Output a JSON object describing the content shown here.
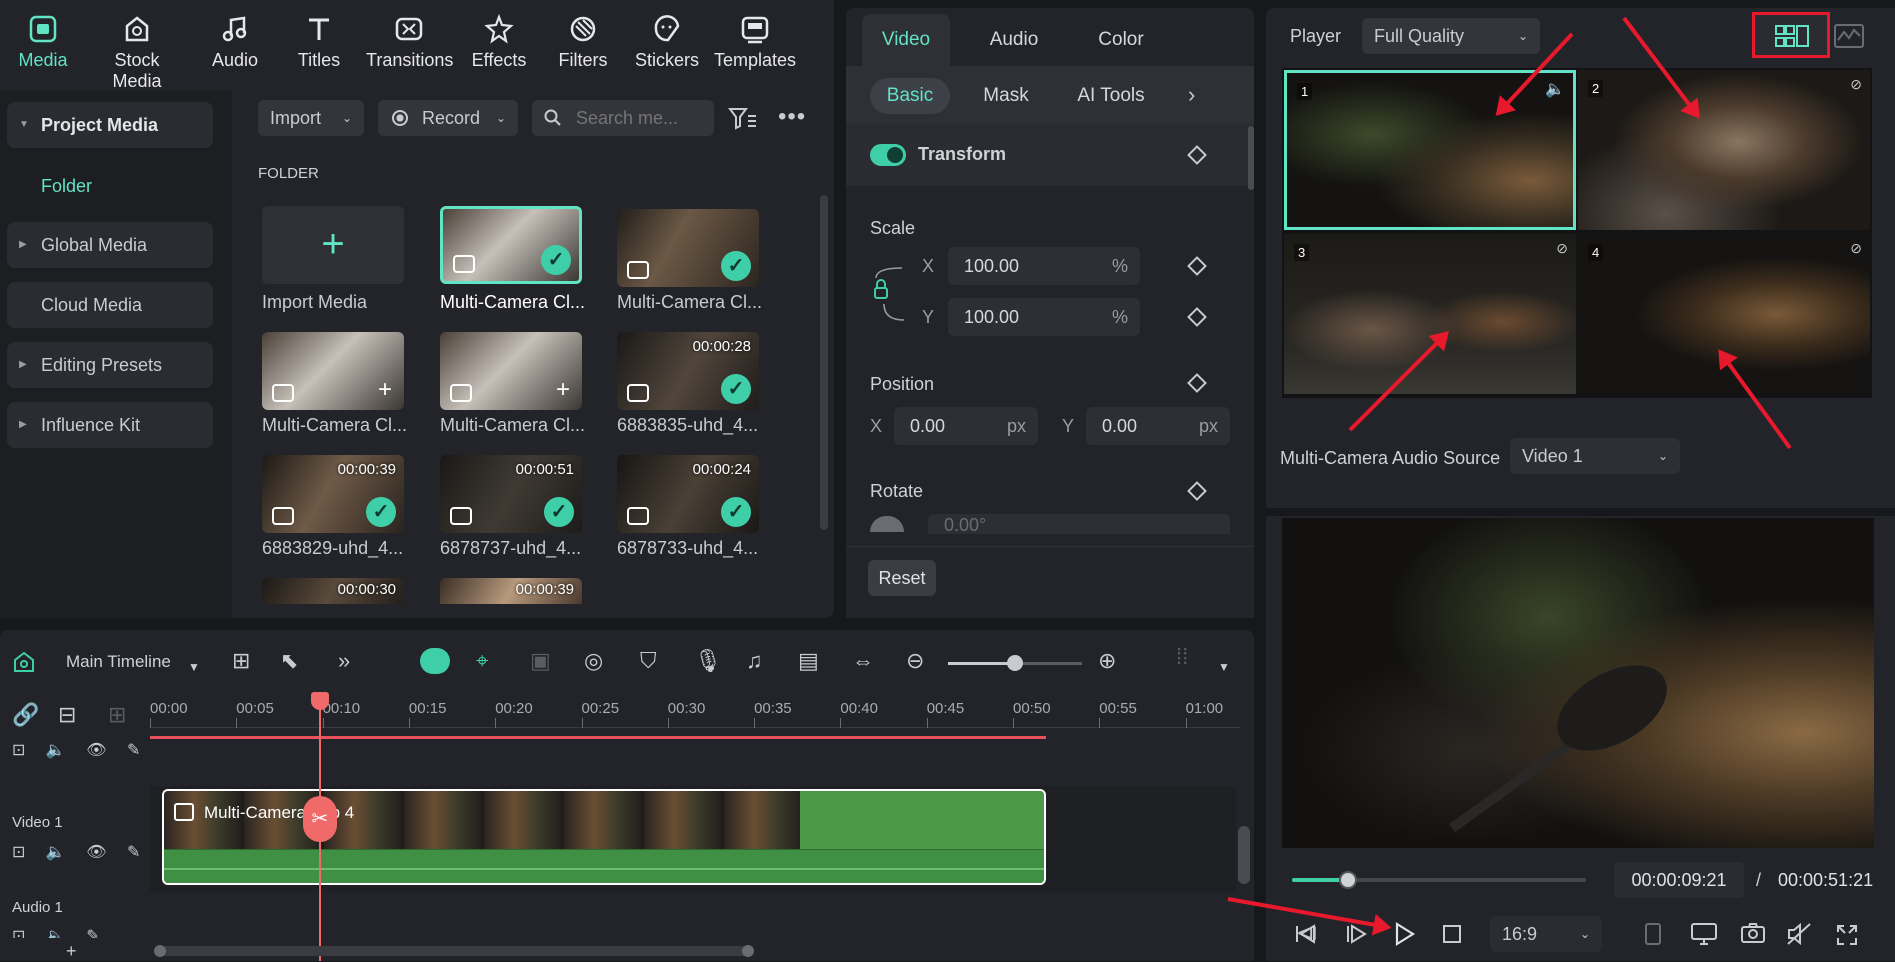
{
  "toolbar": {
    "items": [
      {
        "label": "Media",
        "icon": "media-icon"
      },
      {
        "label": "Stock Media",
        "icon": "stock-media-icon"
      },
      {
        "label": "Audio",
        "icon": "audio-icon"
      },
      {
        "label": "Titles",
        "icon": "titles-icon"
      },
      {
        "label": "Transitions",
        "icon": "transitions-icon"
      },
      {
        "label": "Effects",
        "icon": "effects-icon"
      },
      {
        "label": "Filters",
        "icon": "filters-icon"
      },
      {
        "label": "Stickers",
        "icon": "stickers-icon"
      },
      {
        "label": "Templates",
        "icon": "templates-icon"
      }
    ],
    "accent": "#61e3c5"
  },
  "sidebar": {
    "items": [
      "Project Media",
      "Folder",
      "Global Media",
      "Cloud Media",
      "Editing Presets",
      "Influence Kit"
    ]
  },
  "media": {
    "import_label": "Import",
    "record_label": "Record",
    "search_placeholder": "Search me...",
    "folder_heading": "FOLDER",
    "import_media_label": "Import Media",
    "clips": [
      {
        "label": "Multi-Camera Cl...",
        "duration": "",
        "state": "check"
      },
      {
        "label": "Multi-Camera Cl...",
        "duration": "",
        "state": "check"
      },
      {
        "label": "Multi-Camera Cl...",
        "duration": "",
        "state": "plus"
      },
      {
        "label": "Multi-Camera Cl...",
        "duration": "",
        "state": "plus"
      },
      {
        "label": "6883835-uhd_4...",
        "duration": "00:00:28",
        "state": "check"
      },
      {
        "label": "6883829-uhd_4...",
        "duration": "00:00:39",
        "state": "check"
      },
      {
        "label": "6878737-uhd_4...",
        "duration": "00:00:51",
        "state": "check"
      },
      {
        "label": "6878733-uhd_4...",
        "duration": "00:00:24",
        "state": "check"
      },
      {
        "label": "",
        "duration": "00:00:30",
        "state": ""
      },
      {
        "label": "",
        "duration": "00:00:39",
        "state": ""
      }
    ]
  },
  "inspector": {
    "tabs": [
      "Video",
      "Audio",
      "Color"
    ],
    "subtabs": [
      "Basic",
      "Mask",
      "AI Tools"
    ],
    "transform_label": "Transform",
    "scale_label": "Scale",
    "scale_x": "100.00",
    "scale_y": "100.00",
    "scale_unit": "%",
    "position_label": "Position",
    "pos_x": "0.00",
    "pos_y": "0.00",
    "pos_unit": "px",
    "rotate_label": "Rotate",
    "rotate_value": "0.00°",
    "reset_label": "Reset",
    "axis_x": "X",
    "axis_y": "Y"
  },
  "player": {
    "label": "Player",
    "quality": "Full Quality",
    "cams": [
      "1",
      "2",
      "3",
      "4"
    ],
    "audio_source_label": "Multi-Camera Audio Source",
    "audio_source_value": "Video 1",
    "current_time": "00:00:09:21",
    "total_time": "00:00:51:21",
    "separator": "/",
    "aspect": "16:9",
    "progress": 0.19
  },
  "timeline": {
    "name": "Main Timeline",
    "ticks": [
      "00:00",
      "00:05",
      "00:10",
      "00:15",
      "00:20",
      "00:25",
      "00:30",
      "00:35",
      "00:40",
      "00:45",
      "00:50",
      "00:55",
      "01:00"
    ],
    "video_track": "Video 1",
    "audio_track": "Audio 1",
    "clip_label": "Multi-Camera Clip 4",
    "zoom": 0.5
  }
}
